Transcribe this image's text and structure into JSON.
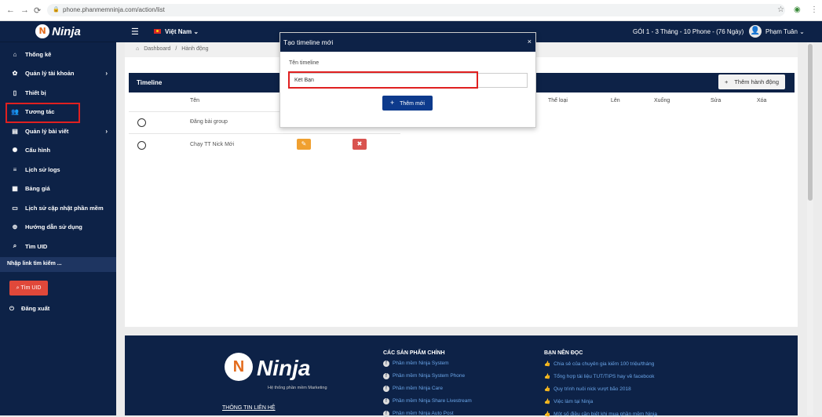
{
  "browser": {
    "url": "phone.phanmemninja.com/action/list",
    "back_icon": "←",
    "forward_icon": "→",
    "reload_icon": "⟳"
  },
  "sidebar": {
    "logo_mark": "N",
    "logo_text": "Ninja",
    "items": [
      {
        "icon": "⌂",
        "label": "Thống kê",
        "has_chevron": false
      },
      {
        "icon": "✿",
        "label": "Quản lý tài khoản",
        "has_chevron": true
      },
      {
        "icon": "▯",
        "label": "Thiết bị",
        "has_chevron": false
      },
      {
        "icon": "👥",
        "label": "Tương tác",
        "has_chevron": false
      },
      {
        "icon": "▤",
        "label": "Quản lý bài viết",
        "has_chevron": true
      },
      {
        "icon": "✺",
        "label": "Cấu hình",
        "has_chevron": false
      },
      {
        "icon": "≡",
        "label": "Lịch sử logs",
        "has_chevron": false
      },
      {
        "icon": "▦",
        "label": "Bảng giá",
        "has_chevron": false
      },
      {
        "icon": "▭",
        "label": "Lịch sử cập nhật phần mềm",
        "has_chevron": false
      },
      {
        "icon": "⊕",
        "label": "Hướng dẫn sử dụng",
        "has_chevron": false
      },
      {
        "icon": "⌕",
        "label": "Tìm UID",
        "has_chevron": false
      }
    ],
    "search_label": "Nhập link tìm kiếm ...",
    "find_uid_button": "Tìm UID",
    "logout_label": "Đăng xuất",
    "chevron": "›"
  },
  "topbar": {
    "menu_icon": "☰",
    "language": "Việt Nam",
    "language_chevron": "⌄",
    "package": "GÓI 1 - 3 Tháng - 10 Phone - (76 Ngày)",
    "user_name": "Phạm Tuân",
    "user_chevron": "⌄",
    "avatar_icon": "👤"
  },
  "breadcrumb": {
    "home": "Dashboard",
    "separator": "/",
    "current": "Hành động"
  },
  "timeline_panel": {
    "title": "Timeline",
    "add_action_button": "Thêm hành động",
    "columns": [
      "Tên",
      "Thể loại",
      "Lên",
      "Xuống",
      "Sửa",
      "Xóa"
    ],
    "rows": [
      {
        "name": "Đăng bài group"
      },
      {
        "name": "Chạy TT Nick Mới"
      }
    ]
  },
  "modal": {
    "title": "Tạo timeline mới",
    "close_icon": "×",
    "field_label": "Tên timeline",
    "field_value": "Kết Bạn",
    "submit_button": "Thêm mới"
  },
  "footer": {
    "logo_text": "Ninja",
    "tagline": "Hệ thống phần mềm Marketing",
    "contact": "THÔNG TIN LIÊN HỆ",
    "products_title": "CÁC SẢN PHẨM CHÍNH",
    "products": [
      "Phần mềm Ninja System",
      "Phần mềm Ninja System Phone",
      "Phần mềm Ninja Care",
      "Phần mềm Ninja Share Livestream",
      "Phần mềm Ninja Auto Post"
    ],
    "read_title": "BẠN NÊN ĐỌC",
    "reads": [
      "Chia sẻ của chuyên gia kiếm 100 triệu/tháng",
      "Tổng hợp tài liệu TUT/TIPS hay về facebook",
      "Quy trình nuôi nick vượt bão 2018",
      "Việc làm tại Ninja",
      "Một số điều cần biết khi mua phần mềm Ninja"
    ]
  },
  "colors": {
    "navy": "#0d2247",
    "danger": "#e0483a",
    "primary": "#0d3a8c",
    "warning": "#f0a030"
  }
}
